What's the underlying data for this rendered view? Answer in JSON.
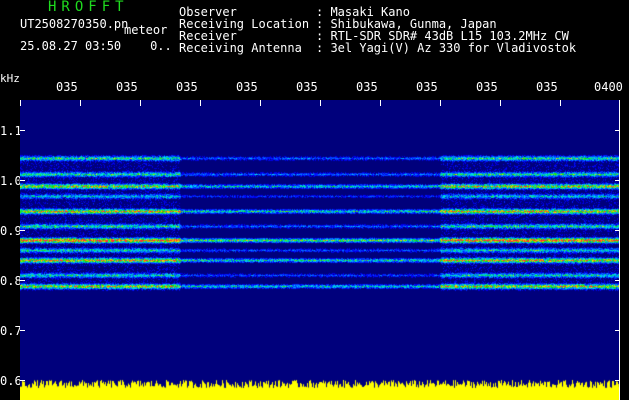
{
  "header": {
    "brand": "HROFFT",
    "filename": "UT2508270350.pn",
    "mode_label": "meteor",
    "date_time": "25.08.27 03:50",
    "count": "0..",
    "info": [
      {
        "key": "Observer",
        "value": "Masaki Kano"
      },
      {
        "key": "Receiving Location",
        "value": "Shibukawa, Gunma, Japan"
      },
      {
        "key": "Receiver",
        "value": "RTL-SDR SDR# 43dB L15 103.2MHz CW"
      },
      {
        "key": "Receiving Antenna",
        "value": "3el Yagi(V) Az 330 for Vladivostok"
      }
    ]
  },
  "axis": {
    "unit": "kHz",
    "time_ticks": [
      "035",
      "035",
      "035",
      "035",
      "035",
      "035",
      "035",
      "035",
      "035",
      "0400"
    ],
    "freq_ticks": [
      "1.1",
      "1.0",
      "0.9",
      "0.8",
      "0.7",
      "0.6"
    ]
  },
  "colors": {
    "background": "#00007c",
    "brand": "#1fdc1f",
    "signal_base": "#ffff00"
  }
}
